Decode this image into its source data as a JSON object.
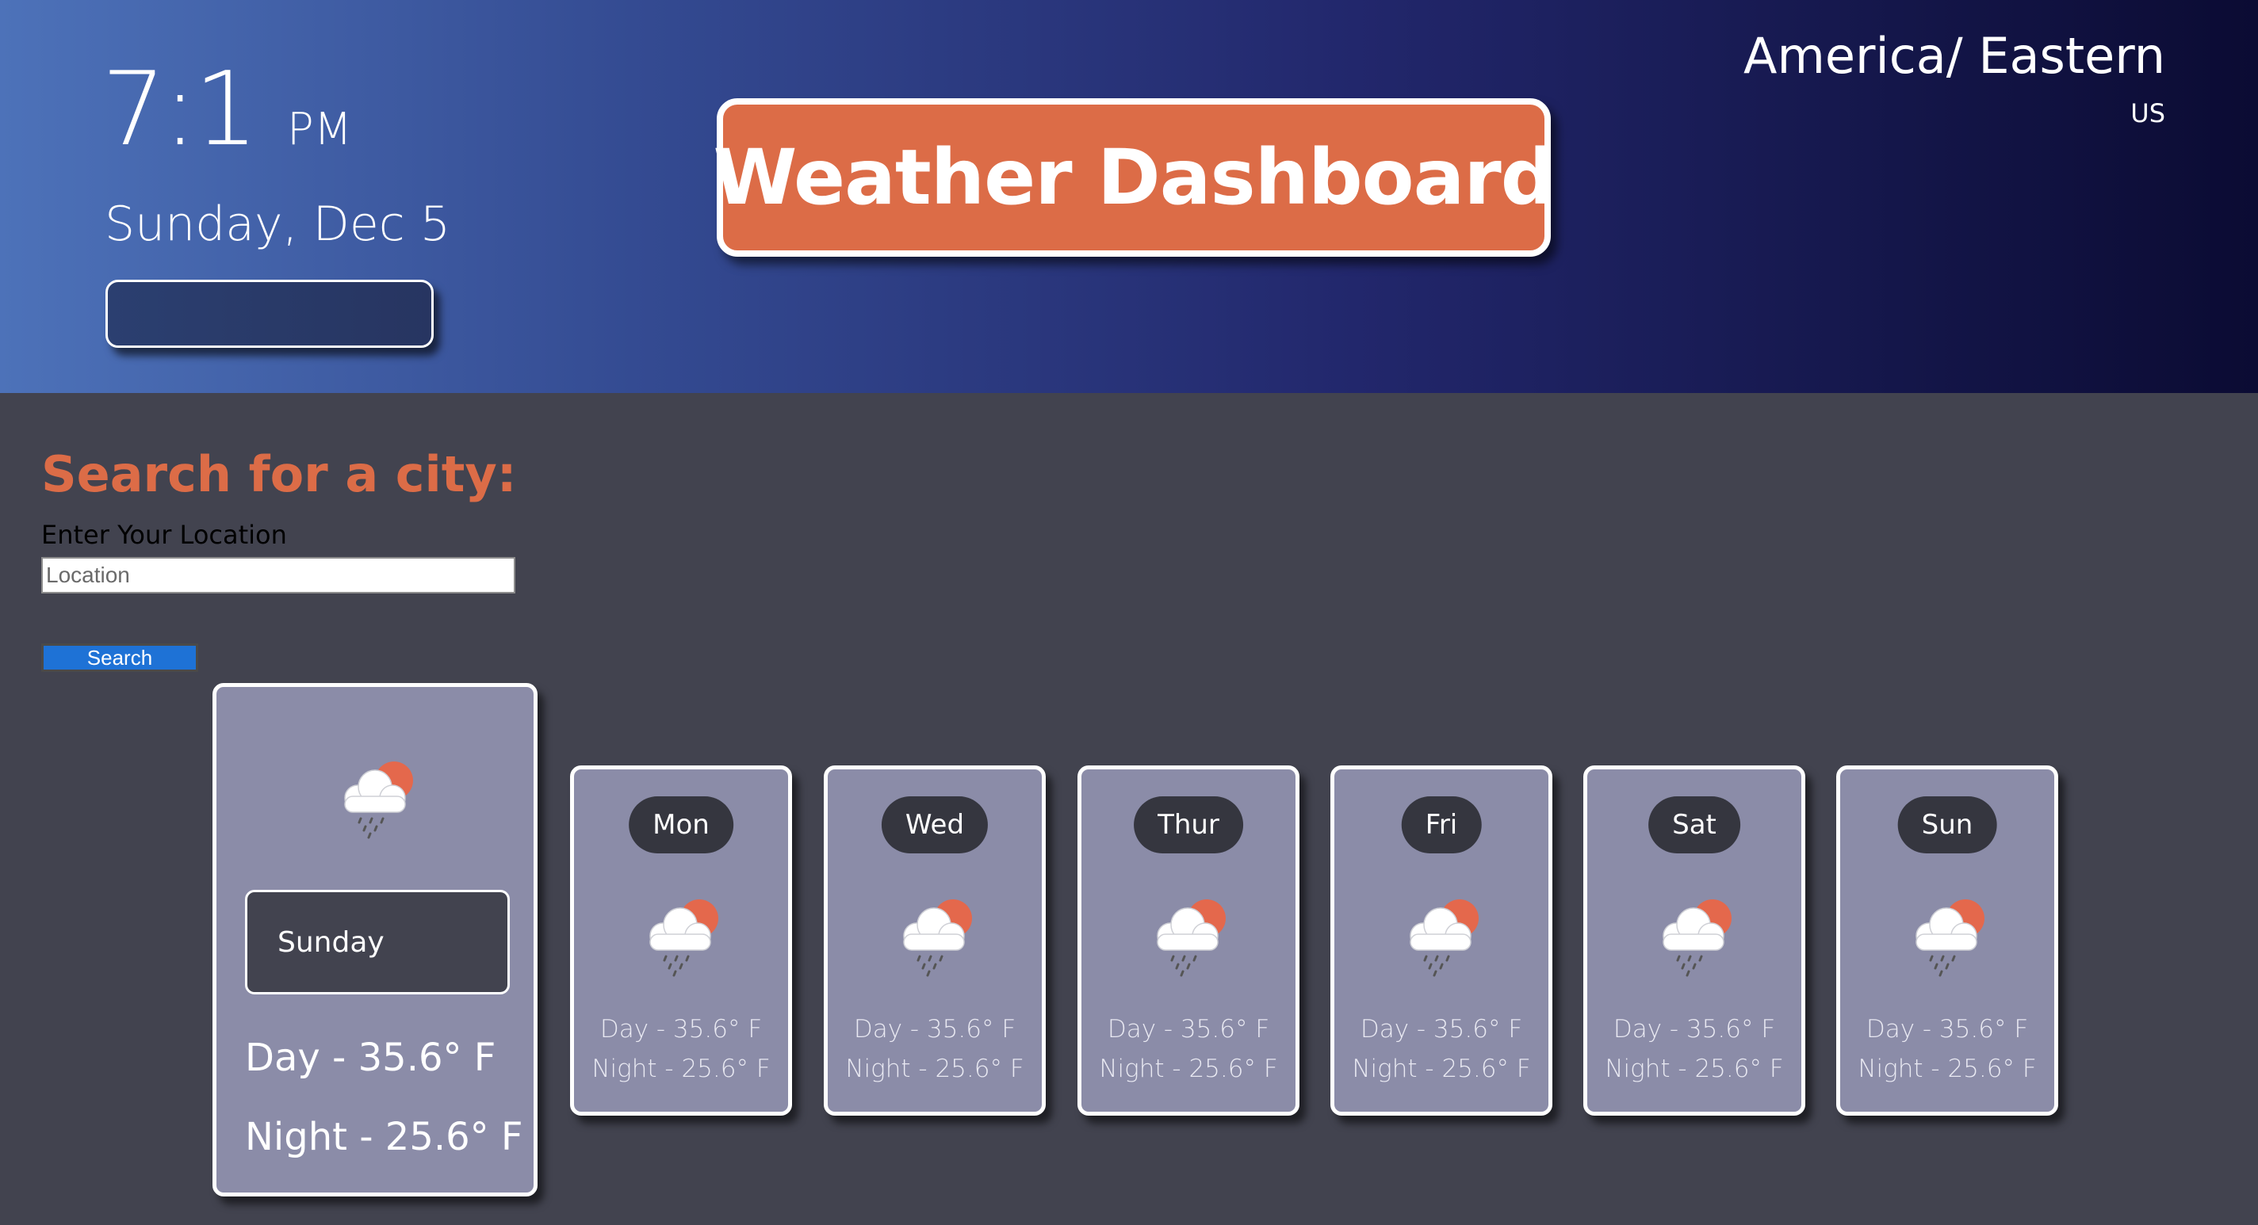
{
  "header": {
    "time": "7:1",
    "ampm": "PM",
    "date": "Sunday, Dec 5",
    "title": "Weather Dashboard",
    "timezone": "America/ Eastern",
    "country": "US"
  },
  "search": {
    "heading": "Search for a city:",
    "label": "Enter Your Location",
    "placeholder": "Location",
    "button": "Search"
  },
  "today": {
    "icon": "rain-cloud-sun-icon",
    "day": "Sunday",
    "day_temp": "Day - 35.6° F",
    "night_temp": "Night - 25.6° F"
  },
  "forecast": [
    {
      "day": "Mon",
      "icon": "rain-cloud-sun-icon",
      "day_temp": "Day - 35.6° F",
      "night_temp": "Night - 25.6° F"
    },
    {
      "day": "Wed",
      "icon": "rain-cloud-sun-icon",
      "day_temp": "Day - 35.6° F",
      "night_temp": "Night - 25.6° F"
    },
    {
      "day": "Thur",
      "icon": "rain-cloud-sun-icon",
      "day_temp": "Day - 35.6° F",
      "night_temp": "Night - 25.6° F"
    },
    {
      "day": "Fri",
      "icon": "rain-cloud-sun-icon",
      "day_temp": "Day - 35.6° F",
      "night_temp": "Night - 25.6° F"
    },
    {
      "day": "Sat",
      "icon": "rain-cloud-sun-icon",
      "day_temp": "Day - 35.6° F",
      "night_temp": "Night - 25.6° F"
    },
    {
      "day": "Sun",
      "icon": "rain-cloud-sun-icon",
      "day_temp": "Day - 35.6° F",
      "night_temp": "Night - 25.6° F"
    }
  ],
  "colors": {
    "accent": "#dc6c47",
    "card": "#8b8ca8",
    "background": "#42434f",
    "button": "#1e72d6"
  }
}
